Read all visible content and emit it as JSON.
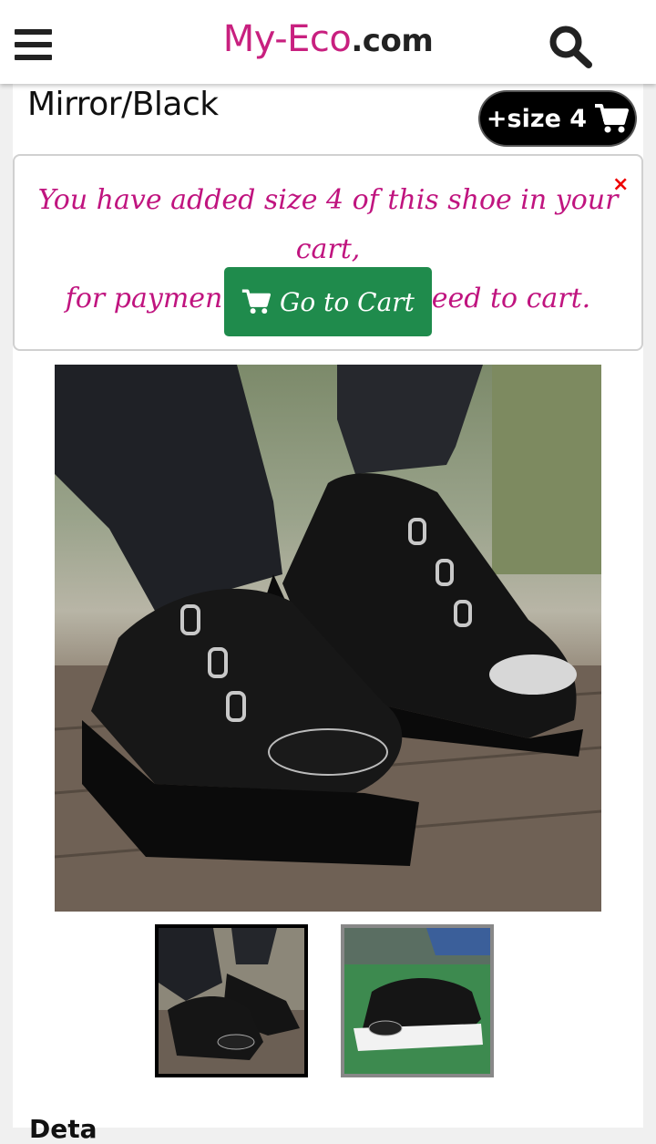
{
  "header": {
    "brand": "My-Eco",
    "tld": ".com",
    "menu_icon": "hamburger-menu-icon",
    "search_icon": "search-icon"
  },
  "product": {
    "variant_title": "Mirror/Black",
    "size_badge_label": "+size 4",
    "size_badge_icon": "cart-icon"
  },
  "notice": {
    "line1": "You have added size 4 of this shoe in your cart,",
    "line2": "for payments please procceed to cart.",
    "close_label": "×",
    "button_label": "Go to Cart",
    "button_icon": "cart-icon"
  },
  "gallery": {
    "main_image": "sneaker-photo",
    "thumbnails": [
      "sneaker-thumb-black-sole",
      "sneaker-thumb-white-sole"
    ]
  },
  "section": {
    "heading": "Deta"
  },
  "colors": {
    "brand": "#c8207f",
    "notice_text": "#c0147f",
    "cart_button": "#1f8b4c",
    "close": "#ee0000"
  }
}
